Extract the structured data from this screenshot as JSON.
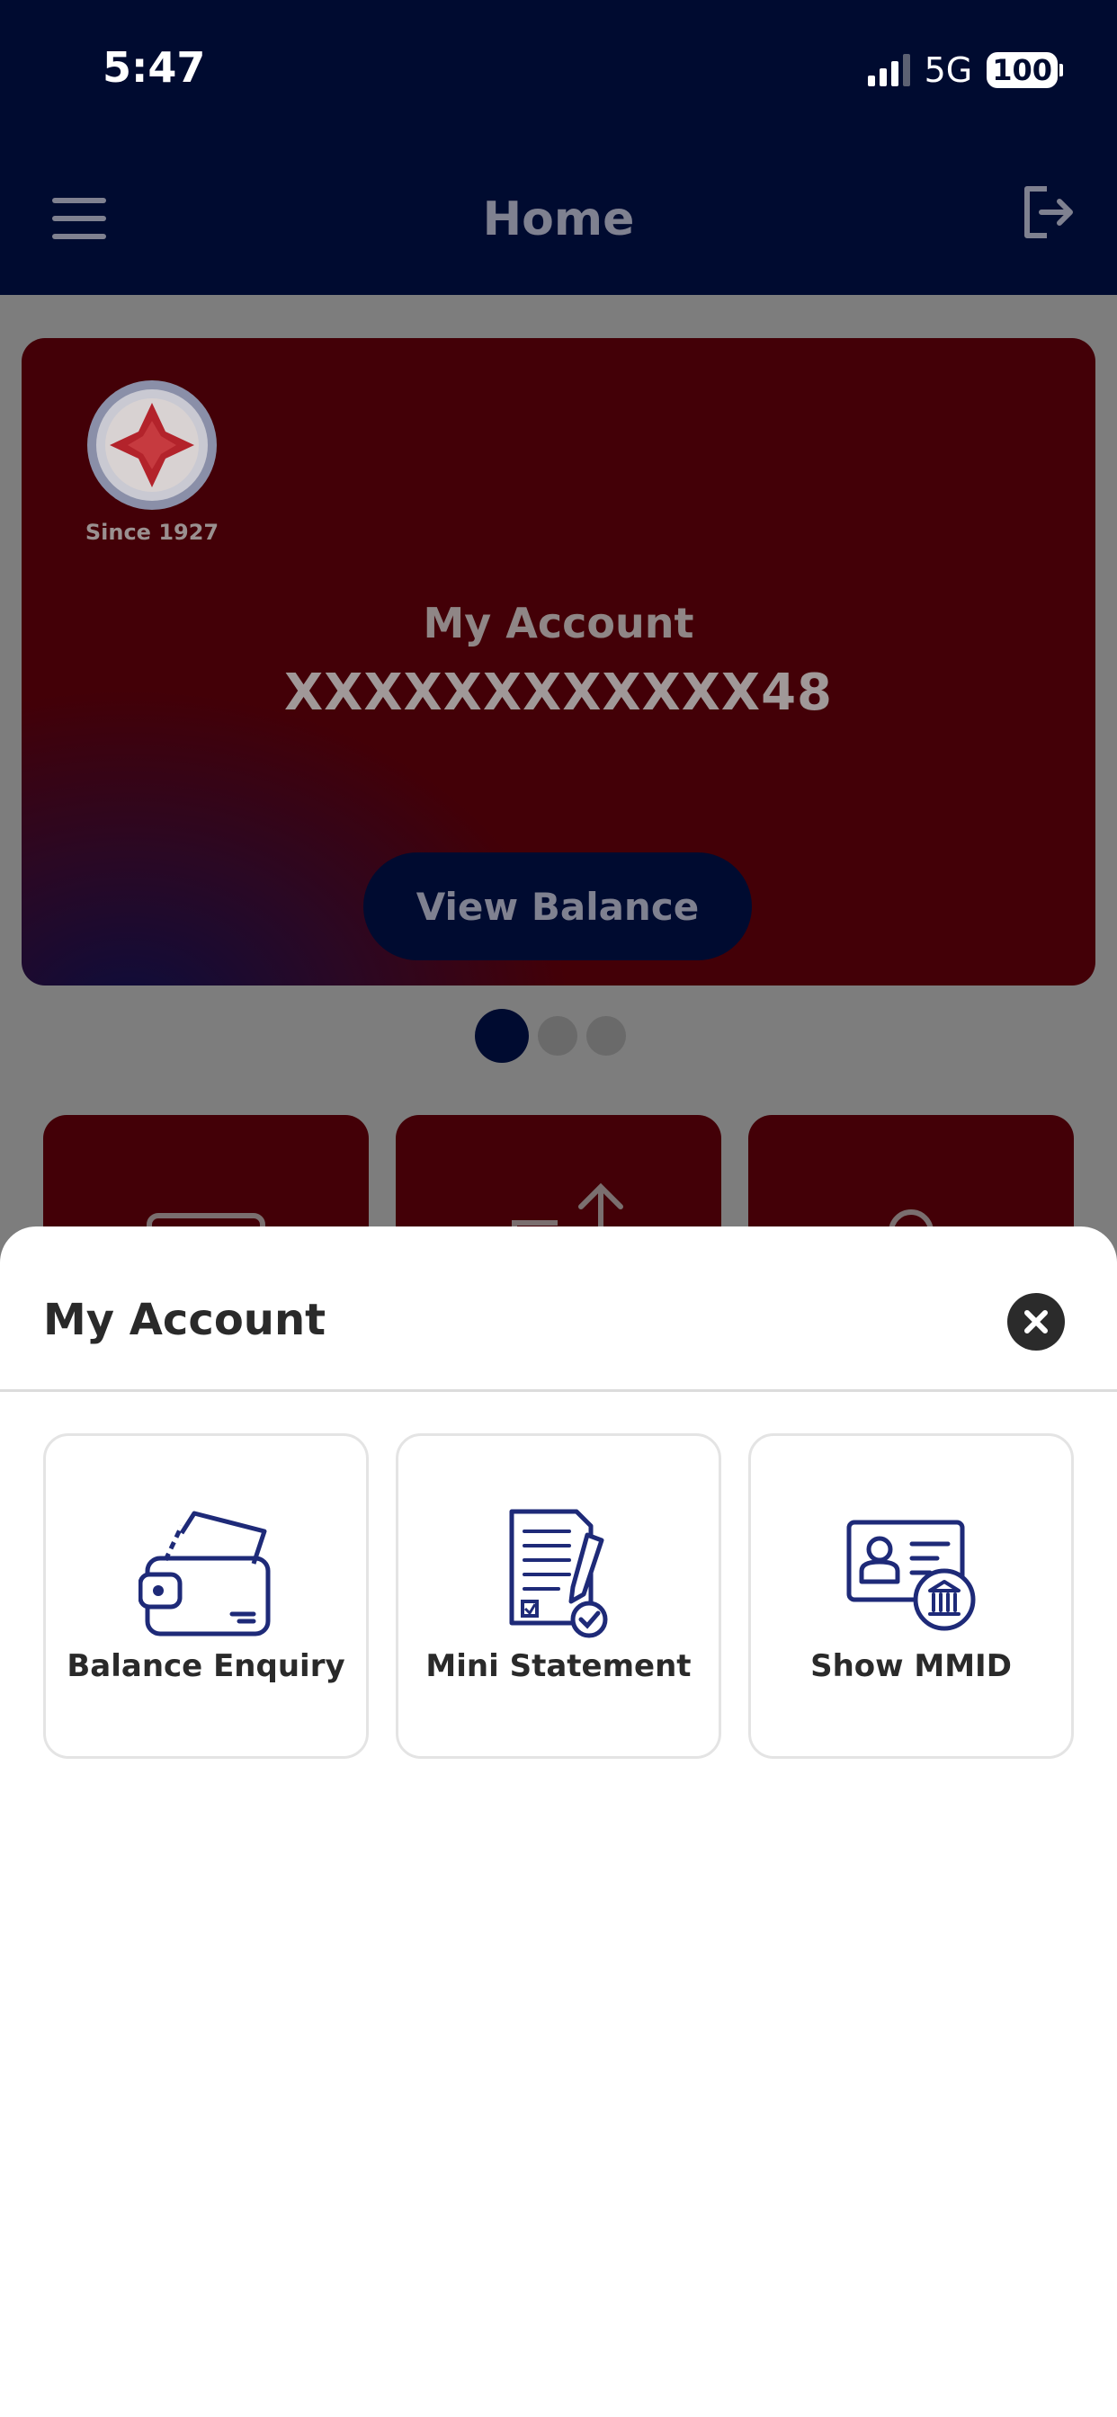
{
  "status_bar": {
    "time": "5:47",
    "network": "5G",
    "battery": "100"
  },
  "header": {
    "title": "Home"
  },
  "account_card": {
    "logo_caption": "Since 1927",
    "label": "My Account",
    "number": "XXXXXXXXXXXX48",
    "view_balance_label": "View Balance"
  },
  "carousel": {
    "pages": 3,
    "active_page": 1
  },
  "sheet": {
    "title": "My Account",
    "options": [
      {
        "label": "Balance Enquiry",
        "icon": "wallet-icon"
      },
      {
        "label": "Mini Statement",
        "icon": "statement-icon"
      },
      {
        "label": "Show MMID",
        "icon": "mmid-card-icon"
      }
    ]
  },
  "colors": {
    "navy": "#000b30",
    "maroon": "#430007",
    "icon_blue": "#1e2a78"
  }
}
